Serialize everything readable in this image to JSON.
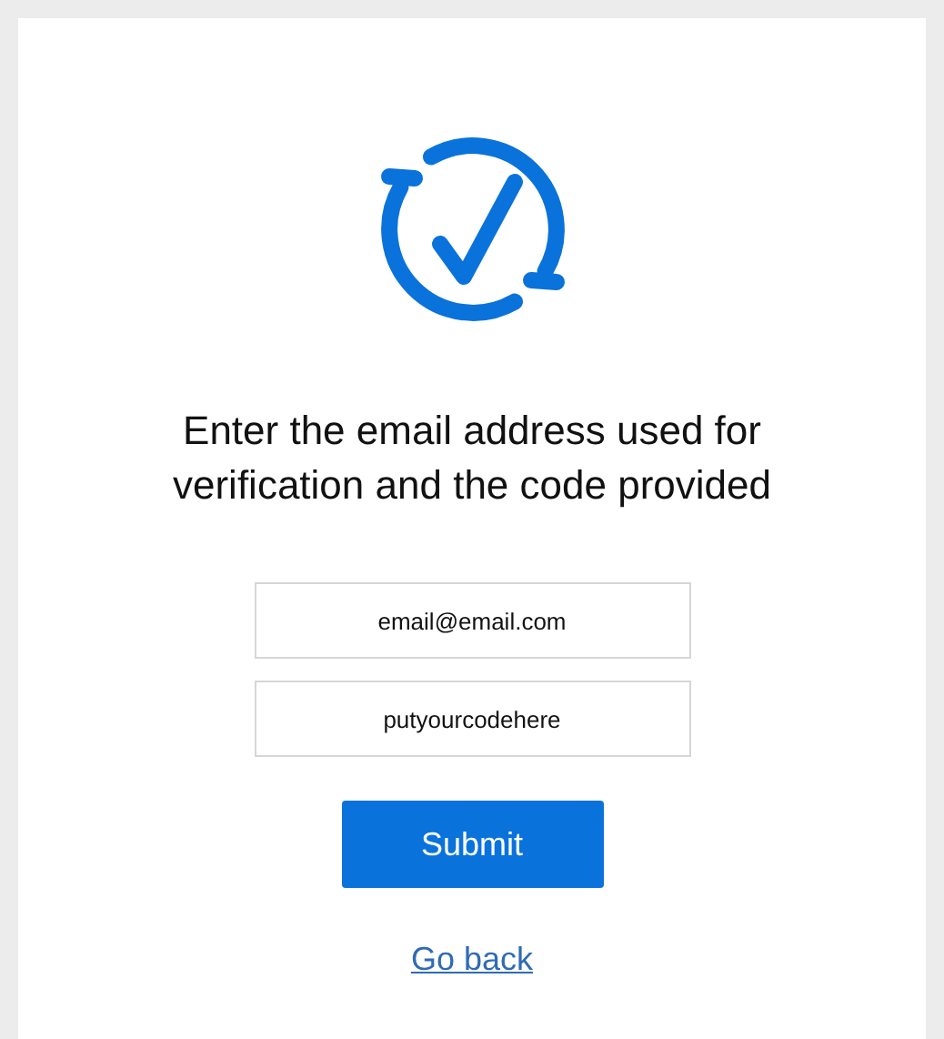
{
  "heading": "Enter the email address used for verification and the code provided",
  "fields": [
    {
      "value": "email@email.com"
    },
    {
      "value": "putyourcodehere"
    }
  ],
  "submit_button": "Submit",
  "back_link": "Go back"
}
